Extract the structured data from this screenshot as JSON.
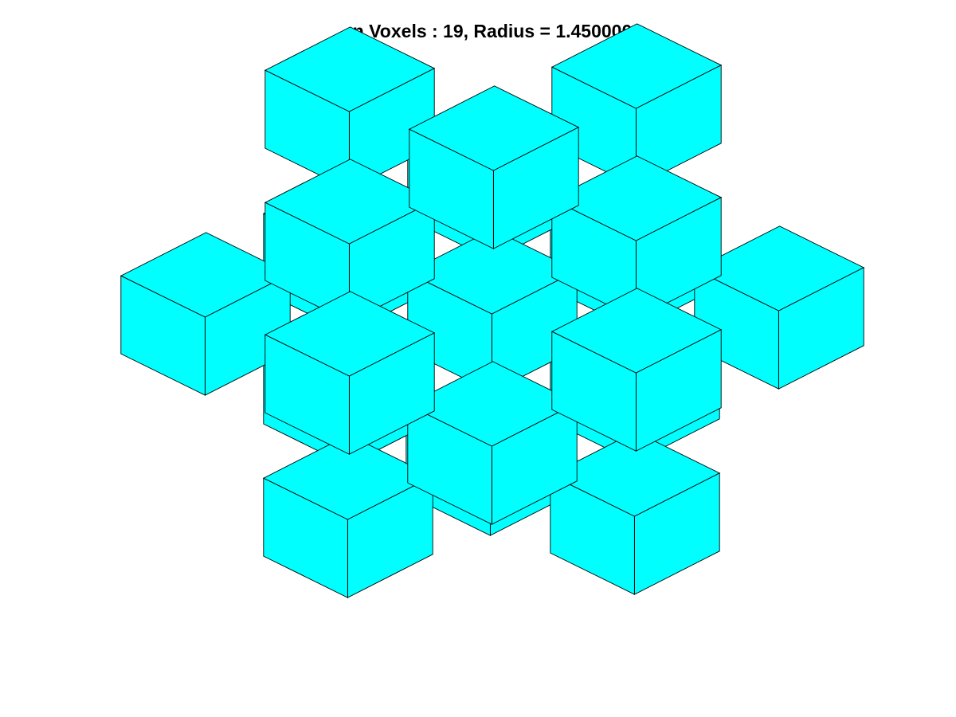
{
  "figure": {
    "title": "n Voxels : 19, Radius = 1.450000"
  },
  "voxel_cloud": {
    "voxel_count": 19,
    "radius": 1.45,
    "voxel_size": 1,
    "face_color": "#00ffff",
    "edge_color": "#000000",
    "background_color": "#ffffff",
    "projection": "orthographic-isometric",
    "axes_visible": false,
    "voxels": [
      [
        -1,
        -1,
        0
      ],
      [
        1,
        -1,
        0
      ],
      [
        -1,
        1,
        0
      ],
      [
        1,
        1,
        0
      ],
      [
        0,
        -1,
        -1
      ],
      [
        -1,
        0,
        -1
      ],
      [
        1,
        0,
        -1
      ],
      [
        0,
        1,
        -1
      ],
      [
        0,
        0,
        -1
      ],
      [
        0,
        -1,
        1
      ],
      [
        -1,
        0,
        1
      ],
      [
        1,
        0,
        1
      ],
      [
        0,
        1,
        1
      ],
      [
        0,
        0,
        1
      ],
      [
        0,
        0,
        0
      ],
      [
        -1,
        0,
        0
      ],
      [
        1,
        0,
        0
      ],
      [
        0,
        -1,
        0
      ],
      [
        0,
        1,
        0
      ]
    ]
  }
}
